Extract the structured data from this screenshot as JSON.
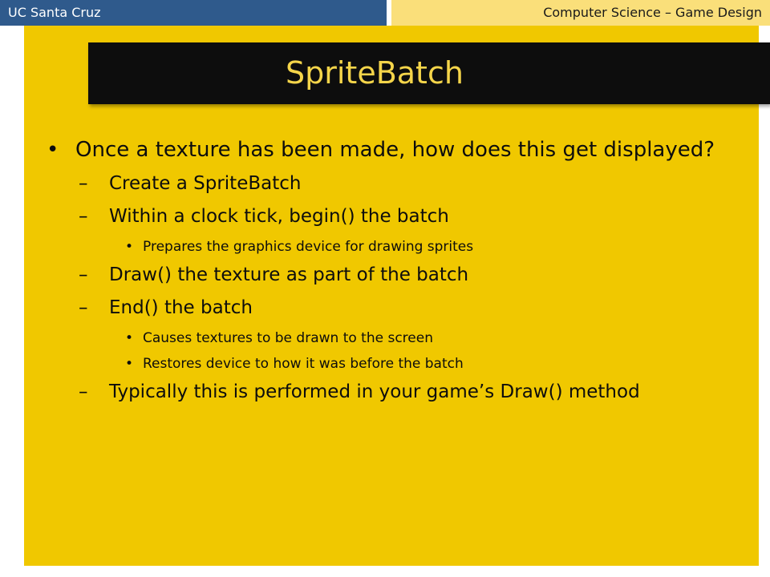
{
  "header": {
    "left_label": "UC Santa Cruz",
    "right_label": "Computer Science – Game Design"
  },
  "slide": {
    "title": "SpriteBatch",
    "bullets": [
      {
        "level": 1,
        "text": "Once a texture has been made, how does this get displayed?"
      },
      {
        "level": 2,
        "text": "Create a SpriteBatch"
      },
      {
        "level": 2,
        "text": "Within a clock tick, begin() the batch"
      },
      {
        "level": 3,
        "text": "Prepares the graphics device for drawing sprites"
      },
      {
        "level": 2,
        "text": "Draw() the texture as part of the batch"
      },
      {
        "level": 2,
        "text": "End() the batch"
      },
      {
        "level": 3,
        "text": "Causes textures to be drawn to the screen"
      },
      {
        "level": 3,
        "text": "Restores device to how it was before the batch"
      },
      {
        "level": 2,
        "text": "Typically this is performed in your game’s Draw() method"
      }
    ],
    "markers": {
      "level1": "•",
      "level2": "–",
      "level3": "•"
    }
  },
  "colors": {
    "header_left": "#2f5a8c",
    "header_right": "#fadf7a",
    "content_background": "#f0c800",
    "title_background": "#0d0d0d",
    "title_text": "#f5d54a"
  }
}
